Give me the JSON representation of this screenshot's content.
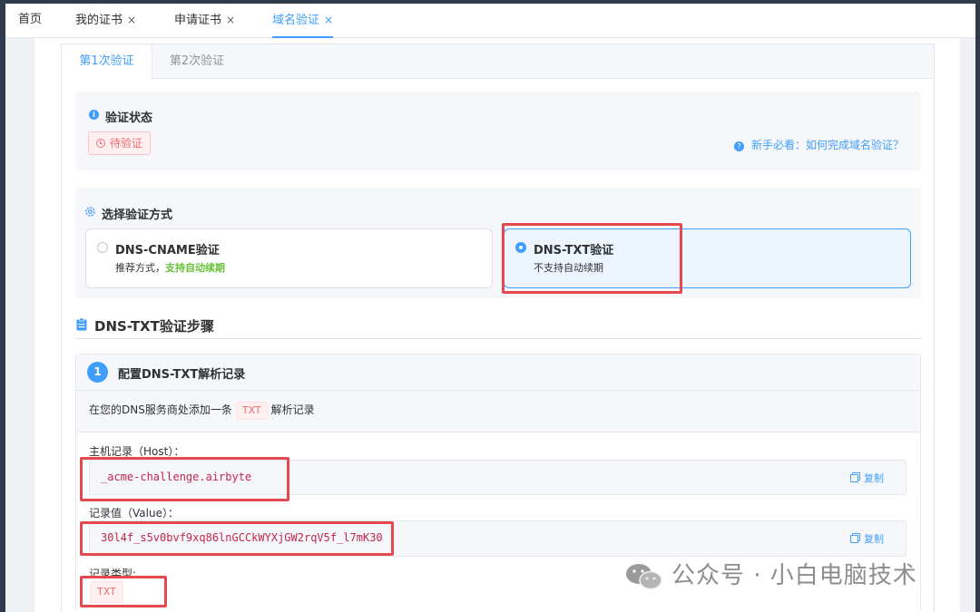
{
  "tabs": [
    {
      "label": "首页",
      "closable": false,
      "active": false
    },
    {
      "label": "我的证书",
      "closable": true,
      "active": false
    },
    {
      "label": "申请证书",
      "closable": true,
      "active": false
    },
    {
      "label": "域名验证",
      "closable": true,
      "active": true
    }
  ],
  "close_glyph": "×",
  "attempt_tabs": [
    {
      "label": "第1次验证",
      "active": true
    },
    {
      "label": "第2次验证",
      "active": false
    }
  ],
  "status": {
    "title": "验证状态",
    "badge": "待验证",
    "help_link": "新手必看：如何完成域名验证？"
  },
  "method": {
    "title": "选择验证方式",
    "options": [
      {
        "title": "DNS-CNAME验证",
        "desc_prefix": "推荐方式，",
        "desc_highlight": "支持自动续期",
        "selected": false
      },
      {
        "title": "DNS-TXT验证",
        "desc_prefix": "不支持自动续期",
        "desc_highlight": "",
        "selected": true
      }
    ]
  },
  "steps": {
    "title": "DNS-TXT验证步骤",
    "step1": {
      "number": "1",
      "title": "配置DNS-TXT解析记录",
      "instr_before": "在您的DNS服务商处添加一条",
      "instr_chip": "TXT",
      "instr_after": "解析记录",
      "host_label": "主机记录（Host）：",
      "host_value": "_acme-challenge.airbyte",
      "value_label": "记录值（Value）：",
      "record_value": "30l4f_s5v0bvf9xq86lnGCCkWYXjGW2rqV5f_l7mK30",
      "type_label": "记录类型:",
      "type_value": "TXT",
      "copy_label": "复制"
    }
  },
  "watermark": "公众号 · 小白电脑技术",
  "colors": {
    "primary": "#409eff",
    "danger": "#f56c6c",
    "success": "#67c23a",
    "annotation": "#e5484d"
  }
}
